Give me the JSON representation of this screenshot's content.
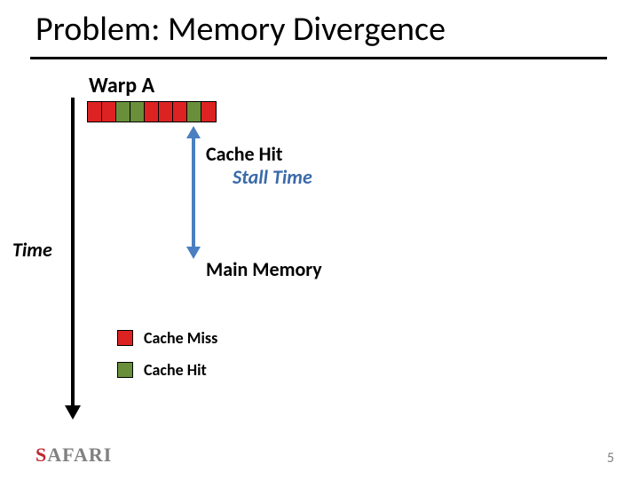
{
  "title": "Problem: Memory Divergence",
  "warp": {
    "label": "Warp A",
    "cells": [
      "miss",
      "miss",
      "hit",
      "hit",
      "miss",
      "miss",
      "miss",
      "hit",
      "miss"
    ]
  },
  "annotations": {
    "cache_hit": "Cache Hit",
    "stall_time": "Stall Time",
    "main_memory": "Main Memory",
    "time_axis": "Time"
  },
  "legend": {
    "miss": "Cache Miss",
    "hit": "Cache Hit"
  },
  "logo": {
    "s": "S",
    "rest": "AFARI"
  },
  "page_number": "5",
  "colors": {
    "miss": "#d22",
    "hit": "#6a8f3b",
    "stall_arrow": "#4a7fc1",
    "stall_text": "#3a6aa8"
  }
}
